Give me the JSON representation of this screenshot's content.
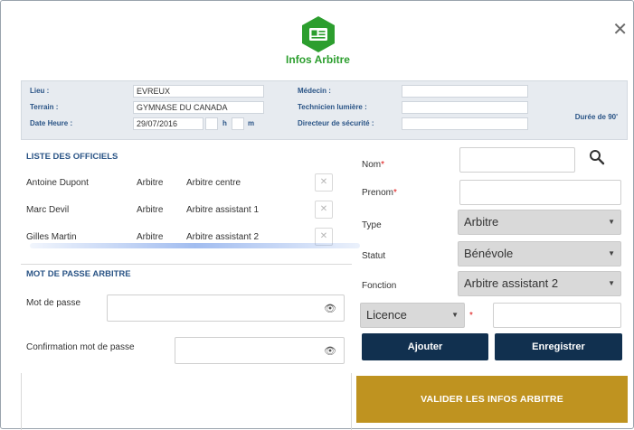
{
  "dialog": {
    "title": "Infos Arbitre",
    "close_glyph": "✕",
    "logo_icon": "id-card-hexagon-icon",
    "accent_color": "#2c9e2e"
  },
  "info": {
    "lieu_label": "Lieu :",
    "lieu_value": "EVREUX",
    "terrain_label": "Terrain :",
    "terrain_value": "GYMNASE DU CANADA",
    "date_label": "Date Heure :",
    "date_value": "29/07/2016",
    "hour_suffix": "h",
    "minute_suffix": "m",
    "medecin_label": "Médecin :",
    "technicien_label": "Technicien lumière :",
    "directeur_label": "Directeur de sécurité :",
    "duree": "Durée de 90'"
  },
  "officiels": {
    "title": "LISTE DES OFFICIELS",
    "rows": [
      {
        "name": "Antoine Dupont",
        "role": "Arbitre",
        "fonction": "Arbitre centre"
      },
      {
        "name": "Marc Devil",
        "role": "Arbitre",
        "fonction": "Arbitre assistant 1"
      },
      {
        "name": "Gilles Martin",
        "role": "Arbitre",
        "fonction": "Arbitre assistant 2"
      }
    ],
    "remove_glyph": "✕"
  },
  "password": {
    "title": "MOT DE PASSE ARBITRE",
    "mdp_label": "Mot de passe",
    "confirm_label": "Confirmation mot de passe",
    "eye_glyph": "👁"
  },
  "form": {
    "nom_label": "Nom",
    "prenom_label": "Prenom",
    "type_label": "Type",
    "type_value": "Arbitre",
    "statut_label": "Statut",
    "statut_value": "Bénévole",
    "fonction_label": "Fonction",
    "fonction_value": "Arbitre assistant 2",
    "licence_value": "Licence",
    "required_mark": "*",
    "caret": "▼",
    "ajouter_label": "Ajouter",
    "enregistrer_label": "Enregistrer"
  },
  "validate_label": "VALIDER LES INFOS ARBITRE"
}
